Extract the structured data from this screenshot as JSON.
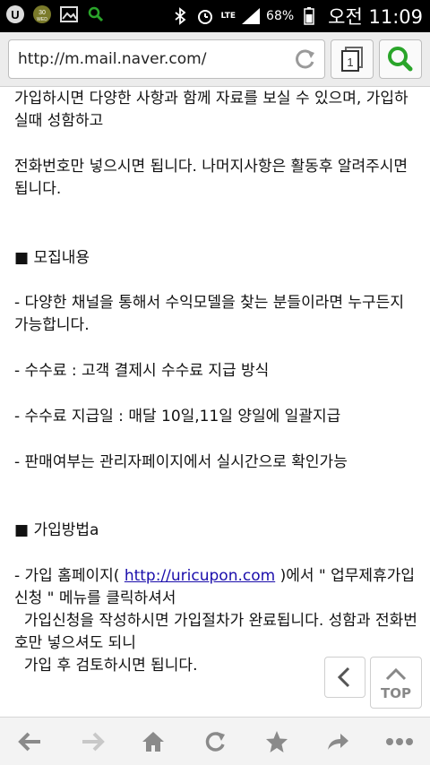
{
  "statusbar": {
    "notif_badge": "30\nWED",
    "network": "LTE",
    "battery_pct": "68%",
    "time": "오전 11:09"
  },
  "browser": {
    "url": "http://m.mail.naver.com/",
    "tab_count": "1"
  },
  "content": {
    "p1": "가입하시면 다양한 사항과 함께 자료를 보실 수 있으며, 가입하실때 성함하고",
    "p2": "전화번호만 넣으시면 됩니다. 나머지사항은 활동후 알려주시면 됩니다.",
    "h1": "■ 모집내용",
    "p3": "- 다양한 채널을 통해서 수익모델을 찾는 분들이라면 누구든지 가능합니다.",
    "p4": "- 수수료 : 고객 결제시 수수료 지급 방식",
    "p5": "- 수수료 지급일 : 매달 10일,11일 양일에 일괄지급",
    "p6": "- 판매여부는 관리자페이지에서 실시간으로 확인가능",
    "h2": "■ 가입방법a",
    "p7_pre": "- 가입 홈페이지( ",
    "p7_link": "http://uricupon.com",
    "p7_post": " )에서 \" 업무제휴가입신청 \" 메뉴를 클릭하셔서",
    "p8": "  가입신청을 작성하시면 가입절차가 완료됩니다. 성함과 전화번호만 넣으셔도 되니",
    "p9": "  가입 후 검토하시면 됩니다."
  },
  "floating": {
    "top_label": "TOP"
  },
  "bottombar": {
    "items": [
      "back-icon",
      "forward-icon",
      "home-icon",
      "refresh-icon",
      "bookmark-icon",
      "share-icon",
      "more-icon"
    ]
  },
  "colors": {
    "link": "#1a0dab",
    "search_green": "#2aa52a"
  }
}
